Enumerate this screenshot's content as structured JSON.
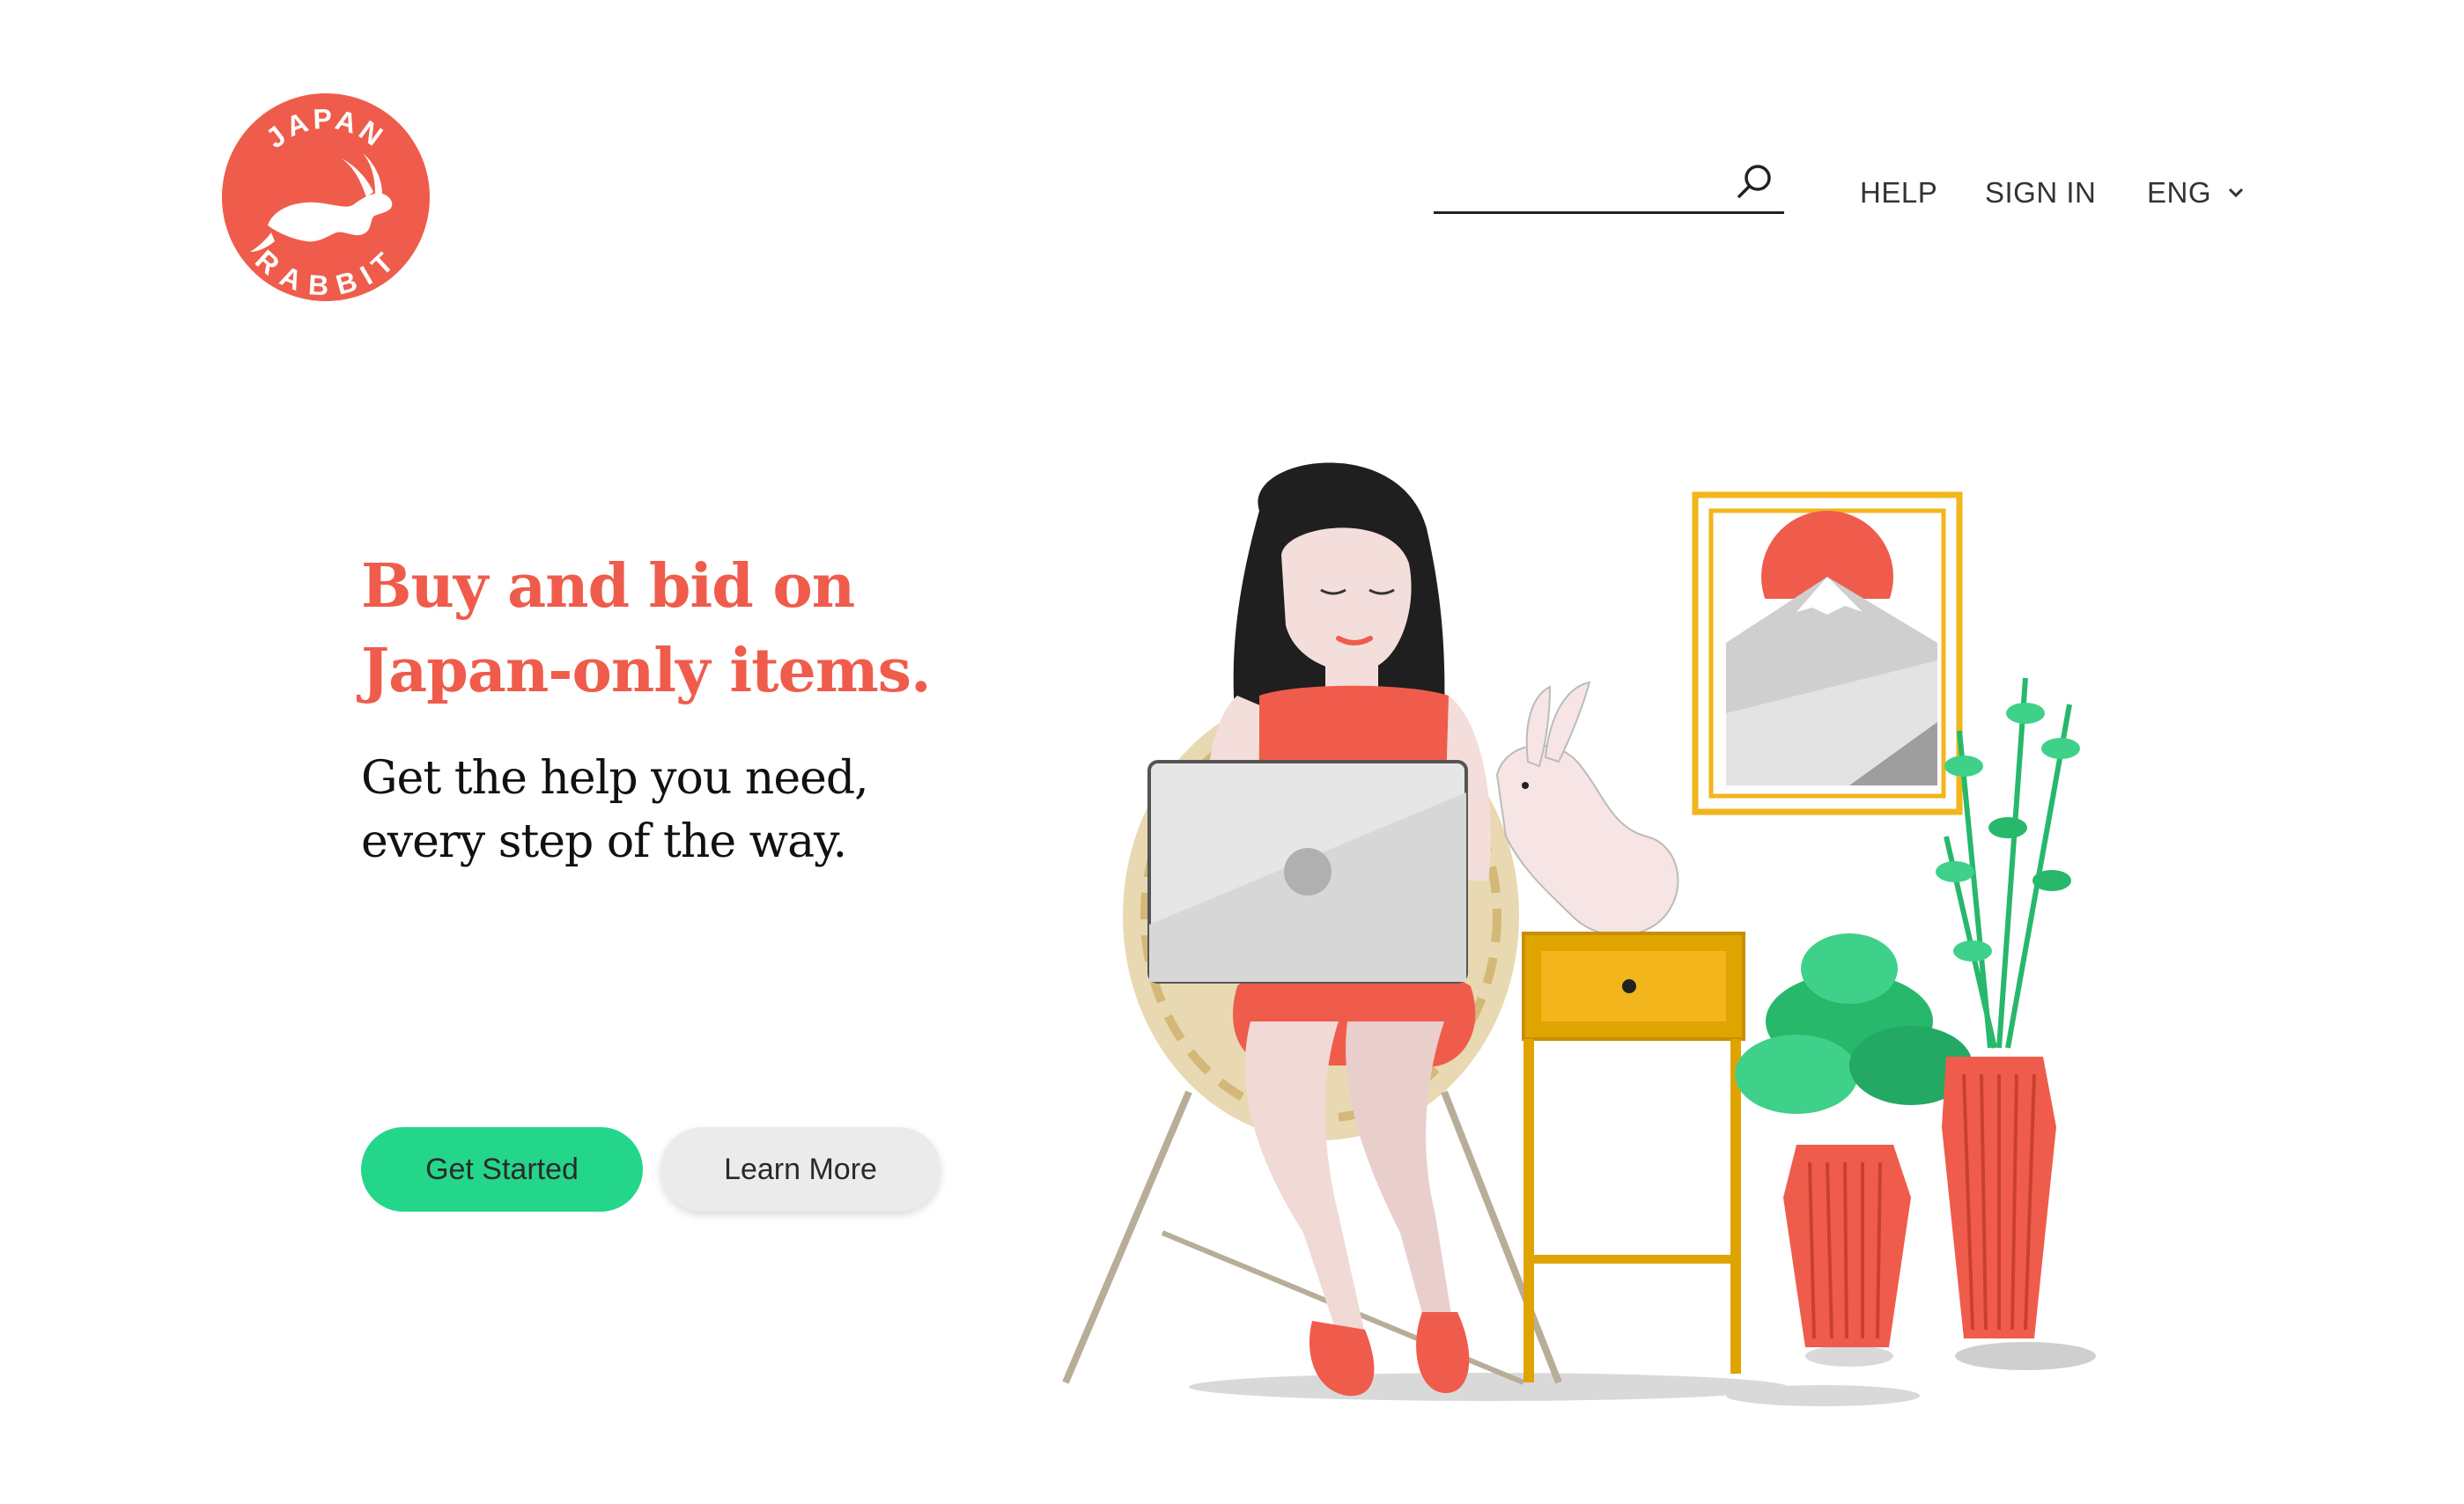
{
  "brand": {
    "logo_text_top": "JAPAN",
    "logo_text_bottom": "RABBIT",
    "logo_icon": "rabbit-icon",
    "accent": "#ef5c4b"
  },
  "header": {
    "search": {
      "placeholder": "",
      "value": "",
      "icon": "search-icon"
    },
    "nav": {
      "help": "HELP",
      "sign_in": "SIGN IN",
      "language": "ENG",
      "language_icon": "chevron-down-icon"
    }
  },
  "hero": {
    "title_line1": "Buy and bid on",
    "title_line2": "Japan-only items.",
    "subtitle_line1": "Get the help you need,",
    "subtitle_line2": "every step of the way.",
    "primary_button": "Get Started",
    "secondary_button": "Learn More",
    "primary_color": "#23d68a"
  }
}
